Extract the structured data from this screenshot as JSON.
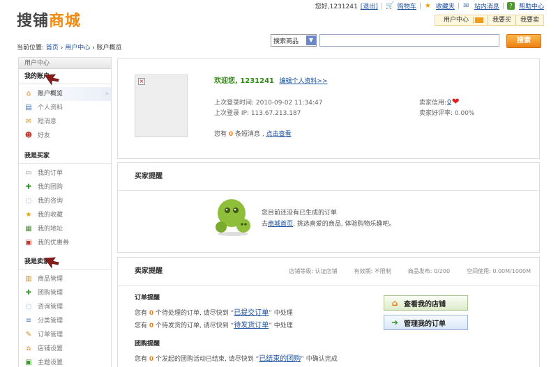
{
  "logo": {
    "part1": "搜铺",
    "part2": "商城"
  },
  "topnav": {
    "greeting": "您好,1231241",
    "logout": "[退出]",
    "cart": "购物车",
    "favorites": "收藏夹",
    "messages": "站内消息",
    "help": "帮助中心"
  },
  "subnav": {
    "user_center": "用户中心",
    "buy": "我要买",
    "sell": "我要卖"
  },
  "breadcrumb": {
    "prefix": "当前位置:",
    "home": "首页",
    "user_center": "用户中心",
    "current": "账户概览",
    "sep": " › "
  },
  "search": {
    "select_value": "搜索商品",
    "placeholder": "",
    "button": "搜索"
  },
  "sidebar": {
    "title": "用户中心",
    "groups": [
      {
        "title": "我的账户",
        "items": [
          "账户概览",
          "个人资料",
          "短消息",
          "好友"
        ]
      },
      {
        "title": "我是买家",
        "items": [
          "我的订单",
          "我的团购",
          "我的咨询",
          "我的收藏",
          "我的地址",
          "我的优惠券"
        ]
      },
      {
        "title": "我是卖家",
        "items": [
          "商品管理",
          "团购管理",
          "咨询管理",
          "分类管理",
          "订单管理",
          "店铺设置",
          "主题设置"
        ]
      }
    ]
  },
  "account": {
    "welcome": "欢迎您, 1231241",
    "edit_profile": "编辑个人资料>>",
    "last_login_time": "上次登录时间: 2010-09-02 11:34:47",
    "last_login_ip": "上次登录 IP: 113.67.213.187",
    "msg_prefix": "您有",
    "msg_count": "0",
    "msg_suffix": "条短消息 ,",
    "msg_link": "点击查看",
    "seller_credit_label": "卖家信用:",
    "seller_credit_value": "0",
    "seller_rate": "卖家好评率: 0.00%"
  },
  "buyer": {
    "title": "买家提醒",
    "line1": "您目前还没有已生成的订单",
    "line2_prefix": "去",
    "line2_link": "商城首页",
    "line2_suffix": ", 挑选喜爱的商品, 体验购物乐趣吧。"
  },
  "seller": {
    "title": "卖家提醒",
    "meta": {
      "shop_level": "店铺等级: 认证店铺",
      "validity": "有效期: 不限制",
      "published": "商品发布: 0/200",
      "space": "空间使用: 0.00M/1000M"
    },
    "order_title": "订单提醒",
    "tip1_prefix": "您有",
    "tip1_count": "0",
    "tip1_mid": "个待处理的订单, 请尽快到 “",
    "tip1_link": "已提交订单",
    "tip1_suffix": "” 中处理",
    "tip2_prefix": "您有",
    "tip2_count": "0",
    "tip2_mid": "个待发货的订单, 请尽快到 “",
    "tip2_link": "待发货订单",
    "tip2_suffix": "” 中处理",
    "group_title": "团购提醒",
    "tip3_prefix": "您有",
    "tip3_count": "0",
    "tip3_mid": "个发起的团购活动已结束, 请尽快到 “",
    "tip3_link": "已结束的团购",
    "tip3_suffix": "” 中确认完成",
    "btn_shop": "查看我的店铺",
    "btn_orders": "管理我的订单"
  }
}
